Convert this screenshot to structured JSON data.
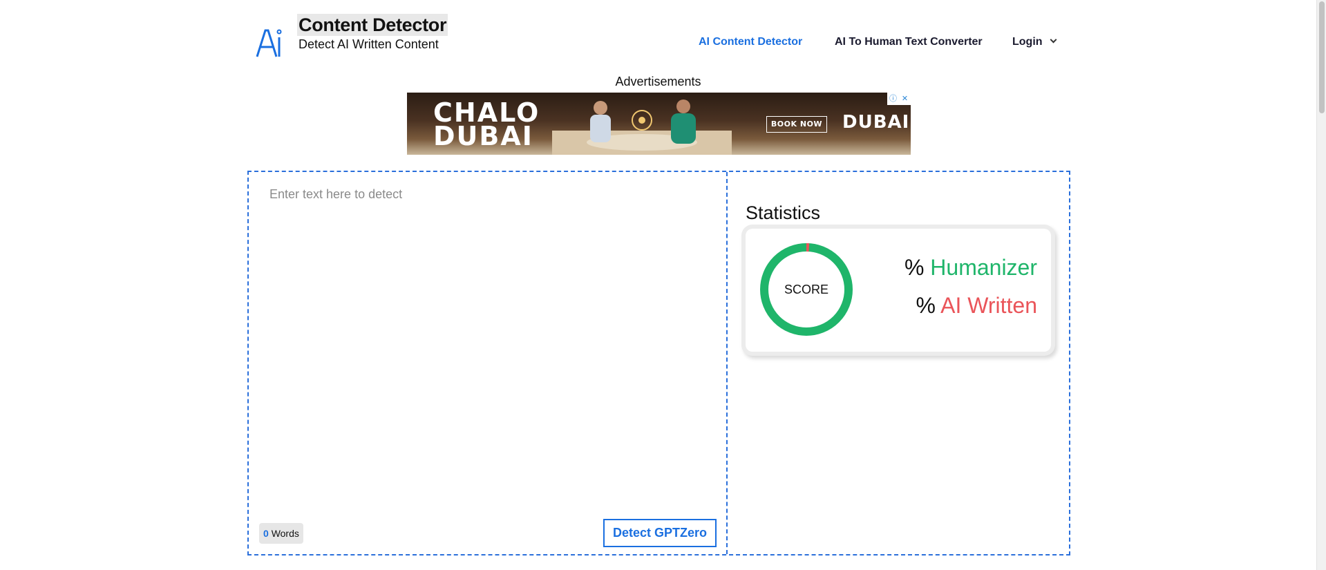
{
  "brand": {
    "title": "Content Detector",
    "subtitle": "Detect AI Written Content",
    "logo_icon": "ai-logo-icon"
  },
  "nav": {
    "items": [
      {
        "label": "AI Content Detector",
        "active": true
      },
      {
        "label": "AI To Human Text Converter",
        "active": false
      },
      {
        "label": "Login",
        "active": false,
        "has_dropdown": true
      }
    ]
  },
  "ads": {
    "label": "Advertisements",
    "banner": {
      "headline_line1": "CHALO",
      "headline_line2": "DUBAI",
      "cta": "BOOK NOW",
      "brand": "DUBAI",
      "info_icon": "ⓘ",
      "close_icon": "✕"
    }
  },
  "editor": {
    "placeholder": "Enter text here to detect",
    "value": "",
    "word_count": "0",
    "word_label": "Words",
    "detect_button": "Detect GPTZero"
  },
  "statistics": {
    "title": "Statistics",
    "score_label": "SCORE",
    "humanizer_label": "Humanizer",
    "ai_label": "AI Written",
    "percent_symbol": "%",
    "colors": {
      "human": "#1fb56a",
      "ai": "#ea5459",
      "accent": "#1a6fe0"
    },
    "ai_fraction": 0.01
  }
}
